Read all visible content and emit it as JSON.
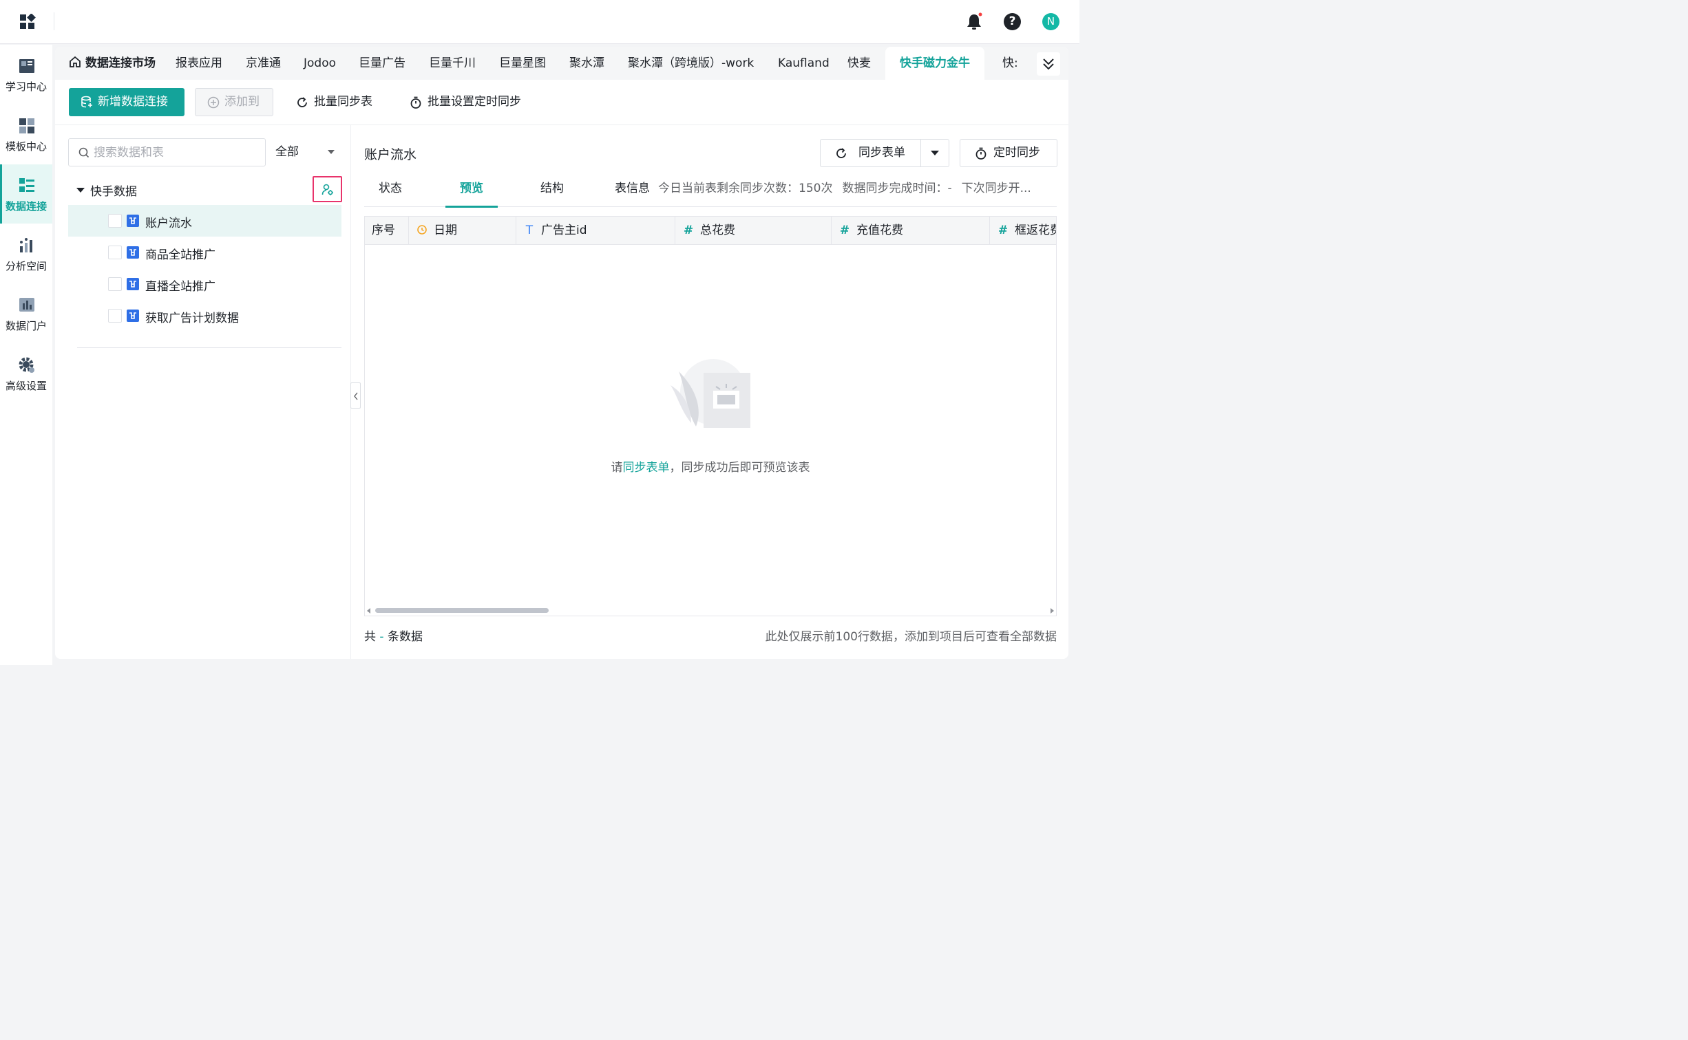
{
  "topbar": {
    "avatar_initial": "N",
    "help_label": "?"
  },
  "leftnav": {
    "items": [
      {
        "label": "学习中心",
        "icon": "book-icon"
      },
      {
        "label": "模板中心",
        "icon": "template-icon"
      },
      {
        "label": "数据连接",
        "icon": "data-connect-icon",
        "active": true
      },
      {
        "label": "分析空间",
        "icon": "analysis-icon"
      },
      {
        "label": "数据门户",
        "icon": "portal-icon"
      },
      {
        "label": "高级设置",
        "icon": "gear-icon"
      }
    ]
  },
  "tabs": {
    "home": "数据连接市场",
    "items": [
      "报表应用",
      "京准通",
      "Jodoo",
      "巨量广告",
      "巨量千川",
      "巨量星图",
      "聚水潭",
      "聚水潭（跨境版）-work",
      "Kaufland",
      "快麦",
      "快手磁力金牛",
      "快:"
    ],
    "active": "快手磁力金牛"
  },
  "toolbar": {
    "new_connection": "新增数据连接",
    "add_to": "添加到",
    "batch_sync": "批量同步表",
    "batch_schedule": "批量设置定时同步"
  },
  "tree": {
    "search_placeholder": "搜索数据和表",
    "filter": "全部",
    "root": "快手数据",
    "items": [
      "账户流水",
      "商品全站推广",
      "直播全站推广",
      "获取广告计划数据"
    ]
  },
  "detail": {
    "title": "账户流水",
    "sync_button": "同步表单",
    "schedule_button": "定时同步",
    "tabs": [
      "状态",
      "预览",
      "结构"
    ],
    "active_tab": "预览",
    "table_info_label": "表信息",
    "info": [
      "今日当前表剩余同步次数：150次",
      "数据同步完成时间：-",
      "下次同步开..."
    ],
    "columns": [
      {
        "type": "",
        "label": "序号"
      },
      {
        "type": "date",
        "label": "日期"
      },
      {
        "type": "text",
        "label": "广告主id"
      },
      {
        "type": "number",
        "label": "总花费"
      },
      {
        "type": "number",
        "label": "充值花费"
      },
      {
        "type": "number",
        "label": "框返花费"
      }
    ],
    "empty": {
      "prefix": "请",
      "link": "同步表单",
      "suffix": "，同步成功后即可预览该表"
    },
    "footer_left": {
      "prefix": "共",
      "count": "-",
      "suffix": "条数据"
    },
    "footer_right": "此处仅展示前100行数据，添加到项目后可查看全部数据"
  },
  "colors": {
    "accent": "#14a39a",
    "highlight": "#e8336b"
  }
}
